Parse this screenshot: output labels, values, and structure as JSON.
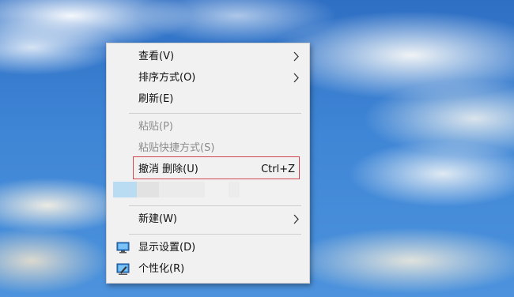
{
  "context_menu": {
    "items": [
      {
        "label": "查看(V)"
      },
      {
        "label": "排序方式(O)"
      },
      {
        "label": "刷新(E)"
      },
      {
        "label": "粘贴(P)"
      },
      {
        "label": "粘贴快捷方式(S)"
      },
      {
        "label": "撤消 删除(U)",
        "shortcut": "Ctrl+Z"
      },
      {
        "label": "新建(W)"
      },
      {
        "label": "显示设置(D)",
        "icon": "display-settings-icon"
      },
      {
        "label": "个性化(R)",
        "icon": "personalize-icon"
      }
    ],
    "highlight_color": "#d3454f"
  }
}
